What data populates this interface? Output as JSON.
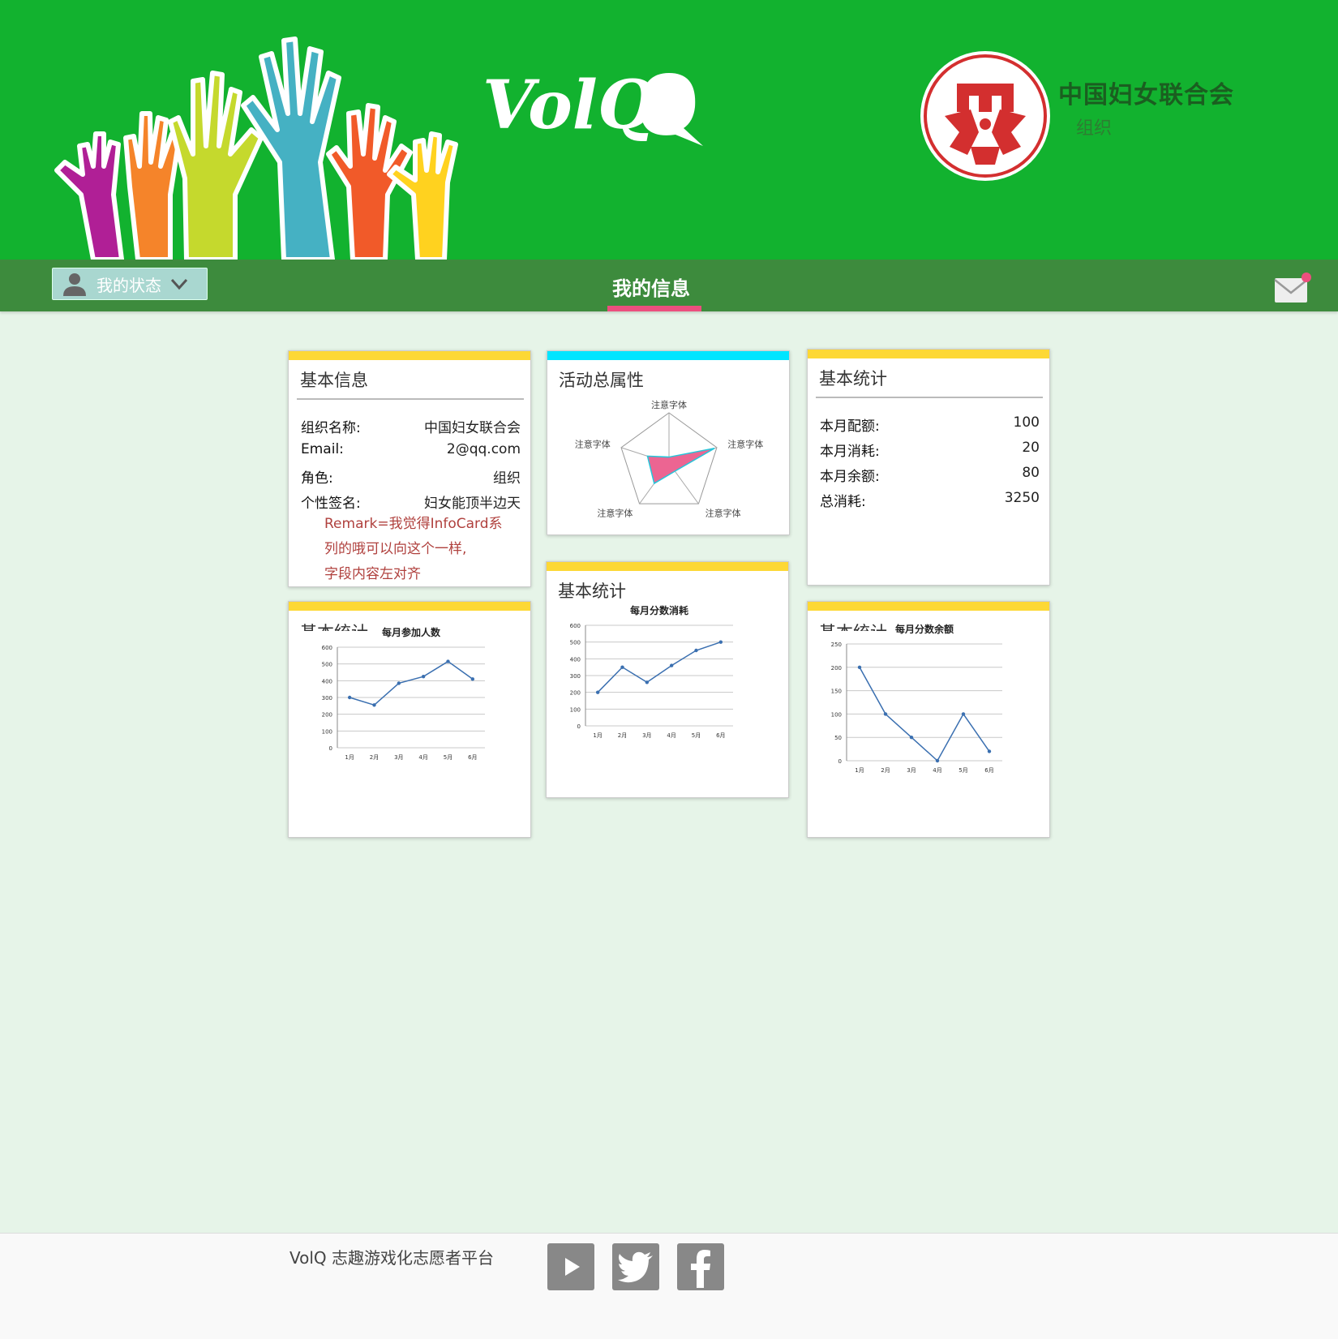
{
  "header": {
    "logo_text": "VolQ",
    "org_name": "中国妇女联合会",
    "org_role": "组织"
  },
  "nav": {
    "status_label": "我的状态",
    "title": "我的信息"
  },
  "cards": {
    "basic_info": {
      "title": "基本信息",
      "rows": [
        {
          "key": "组织名称:",
          "value": "中国妇女联合会"
        },
        {
          "key": "Email:",
          "value": "2@qq.com"
        },
        {
          "key": "角色:",
          "value": "组织"
        },
        {
          "key": "个性签名:",
          "value": "妇女能顶半边天"
        }
      ],
      "remark_lines": [
        "Remark=我觉得InfoCard系",
        "列的哦可以向这个一样,",
        "字段内容左对齐"
      ]
    },
    "activity": {
      "title": "活动总属性",
      "radar_labels": [
        "注意字体",
        "注意字体",
        "注意字体",
        "注意字体",
        "注意字体"
      ]
    },
    "stats_top": {
      "title": "基本统计",
      "rows": [
        {
          "key": "本月配额:",
          "value": "100"
        },
        {
          "key": "本月消耗:",
          "value": "20"
        },
        {
          "key": "本月余额:",
          "value": "80"
        },
        {
          "key": "总消耗:",
          "value": "3250"
        }
      ]
    },
    "stats_mid": {
      "title": "基本统计"
    },
    "stats_bl": {
      "title": "基本统计"
    },
    "stats_br": {
      "title": "基本统计"
    }
  },
  "chart_data": [
    {
      "type": "radar",
      "axes": [
        "注意字体",
        "注意字体",
        "注意字体",
        "注意字体",
        "注意字体"
      ],
      "values": [
        0.12,
        0.95,
        0.2,
        0.5,
        0.45
      ],
      "max": 1,
      "colors": {
        "fill": "#ec6592",
        "stroke": "#26c6da"
      }
    },
    {
      "type": "line",
      "title": "每月参加人数",
      "categories": [
        "1月",
        "2月",
        "3月",
        "4月",
        "5月",
        "6月"
      ],
      "values": [
        300,
        255,
        385,
        425,
        515,
        410
      ],
      "ylim": [
        0,
        600
      ],
      "yticks": [
        0,
        100,
        200,
        300,
        400,
        500,
        600
      ],
      "grid": true,
      "color": "#3a6fb0"
    },
    {
      "type": "line",
      "title": "每月分数消耗",
      "categories": [
        "1月",
        "2月",
        "3月",
        "4月",
        "5月",
        "6月"
      ],
      "values": [
        200,
        350,
        260,
        360,
        450,
        500
      ],
      "ylim": [
        0,
        600
      ],
      "yticks": [
        0,
        100,
        200,
        300,
        400,
        500,
        600
      ],
      "grid": true,
      "color": "#3a6fb0"
    },
    {
      "type": "line",
      "title": "每月分数余额",
      "categories": [
        "1月",
        "2月",
        "3月",
        "4月",
        "5月",
        "6月"
      ],
      "values": [
        200,
        100,
        50,
        0,
        100,
        20
      ],
      "ylim": [
        0,
        250
      ],
      "yticks": [
        0,
        50,
        100,
        150,
        200,
        250
      ],
      "grid": true,
      "color": "#3a6fb0"
    }
  ],
  "footer": {
    "text": "VolQ 志趣游戏化志愿者平台",
    "social": [
      "youtube-icon",
      "twitter-icon",
      "facebook-icon"
    ]
  },
  "colors": {
    "header_bg": "#12b22f",
    "nav_bg": "#3d8b3d",
    "accent_pink": "#ec4f7e",
    "card_yellow": "#fdd835",
    "card_cyan": "#00e5ff",
    "page_bg": "#e6f4e8"
  }
}
